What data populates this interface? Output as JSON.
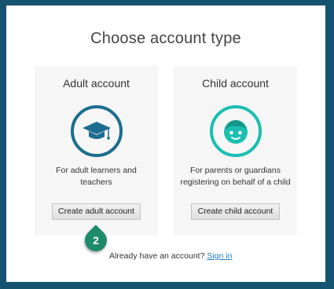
{
  "dialog": {
    "title": "Choose account type",
    "signin_prompt": "Already have an account?",
    "signin_link": "Sign in"
  },
  "adult": {
    "title": "Adult account",
    "icon": "graduation-cap-icon",
    "description": "For adult learners and teachers",
    "button_label": "Create adult account",
    "color": "#1c6e8f"
  },
  "child": {
    "title": "Child account",
    "icon": "child-face-icon",
    "description": "For parents or guardians registering on behalf of a child",
    "button_label": "Create child account",
    "color": "#1bbfb2"
  },
  "step_marker": {
    "number": "2",
    "color": "#1e8a6c"
  },
  "background_color": "#155370"
}
